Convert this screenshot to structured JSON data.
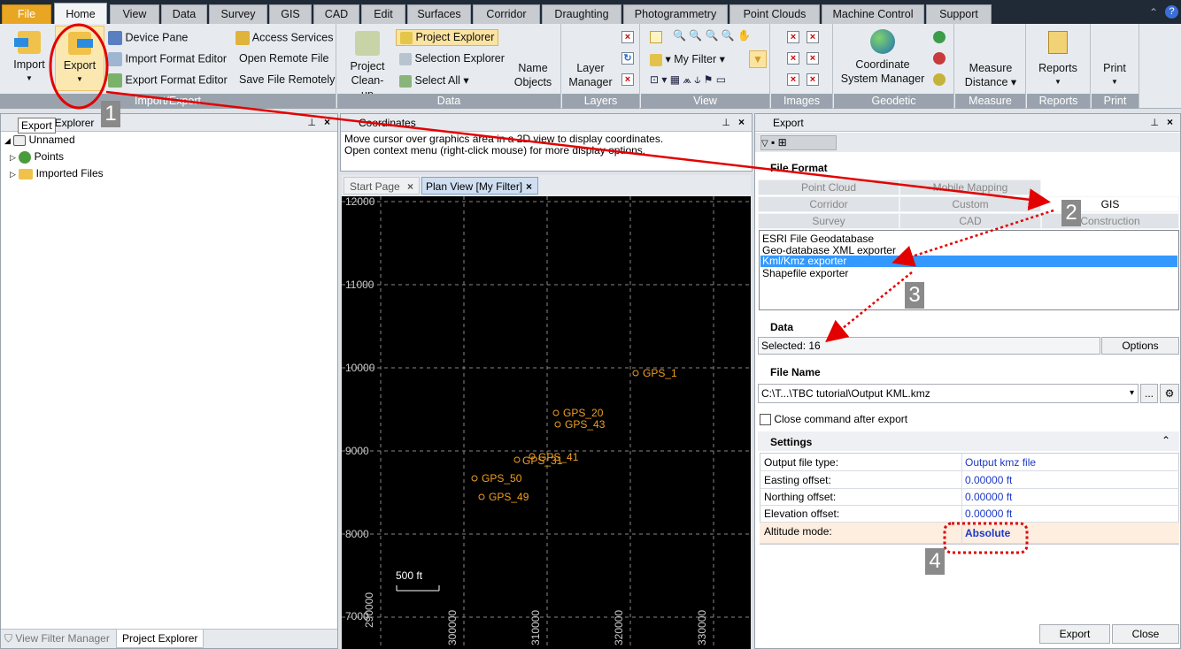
{
  "menu_tabs": [
    "File",
    "Home",
    "View",
    "Data",
    "Survey",
    "GIS",
    "CAD",
    "Edit",
    "Surfaces",
    "Corridor",
    "Draughting",
    "Photogrammetry",
    "Point Clouds",
    "Machine Control",
    "Support"
  ],
  "ribbon": {
    "import_label": "Import",
    "export_label": "Export",
    "export_tooltip": "Export",
    "device_pane": "Device Pane",
    "import_format_editor": "Import Format Editor",
    "export_format_editor": "Export Format Editor",
    "access_services": "Access Services",
    "open_remote_file": "Open Remote File",
    "save_file_remotely": "Save File Remotely",
    "group_import_export": "Import/Export",
    "project_cleanup": "Project Clean-up",
    "project_explorer": "Project Explorer",
    "selection_explorer": "Selection Explorer",
    "select_all": "Select All",
    "name_objects": "Name Objects",
    "group_data": "Data",
    "layer_manager": "Layer Manager",
    "group_layers": "Layers",
    "my_filter": "My Filter",
    "group_view": "View",
    "group_images": "Images",
    "coordinate_system_manager": "Coordinate System Manager",
    "group_geodetic": "Geodetic",
    "measure_distance": "Measure Distance",
    "group_measure": "Measure",
    "reports": "Reports",
    "group_reports": "Reports",
    "print": "Print",
    "group_print": "Print"
  },
  "left_panel": {
    "title": "Project Explorer",
    "tree": [
      "Unnamed",
      "Points",
      "Imported Files"
    ],
    "bottom_tabs": [
      "View Filter Manager",
      "Project Explorer"
    ]
  },
  "coords_panel": {
    "title": "Coordinates",
    "line1": "Move cursor over graphics area in a 2D view to display coordinates.",
    "line2": "Open context menu (right-click mouse) for more display options."
  },
  "doc_tabs": [
    "Start Page",
    "Plan View [My Filter]"
  ],
  "plan_view": {
    "y_ticks": [
      "12000",
      "11000",
      "10000",
      "9000",
      "8000",
      "7000"
    ],
    "x_ticks": [
      "290000",
      "300000",
      "310000",
      "320000",
      "330000"
    ],
    "scale_label": "500 ft",
    "points": [
      "GPS_1",
      "GPS_20",
      "GPS_43",
      "GPS_41",
      "GPS_50",
      "GPS_49",
      "GPS_31"
    ]
  },
  "export_panel": {
    "title": "Export",
    "file_format_heading": "File Format",
    "formats": [
      "Point Cloud",
      "Mobile Mapping",
      "Corridor",
      "Custom",
      "GIS",
      "Survey",
      "CAD",
      "Construction"
    ],
    "exporters": [
      "ESRI File Geodatabase",
      "Geo-database XML exporter",
      "Kml/Kmz exporter",
      "Shapefile exporter"
    ],
    "selected_exporter": "Kml/Kmz exporter",
    "data_heading": "Data",
    "selected_text": "Selected: 16",
    "options_button": "Options",
    "file_name_heading": "File Name",
    "file_path": "C:\\T...\\TBC tutorial\\Output KML.kmz",
    "browse_button": "...",
    "close_after_export": "Close command after export",
    "settings_heading": "Settings",
    "settings": [
      {
        "label": "Output file type:",
        "value": "Output kmz file"
      },
      {
        "label": "Easting offset:",
        "value": "0.00000 ft"
      },
      {
        "label": "Northing offset:",
        "value": "0.00000 ft"
      },
      {
        "label": "Elevation offset:",
        "value": "0.00000 ft"
      },
      {
        "label": "Altitude mode:",
        "value": "Absolute"
      }
    ],
    "export_button": "Export",
    "close_button": "Close"
  },
  "callouts": [
    "1",
    "2",
    "3",
    "4"
  ]
}
